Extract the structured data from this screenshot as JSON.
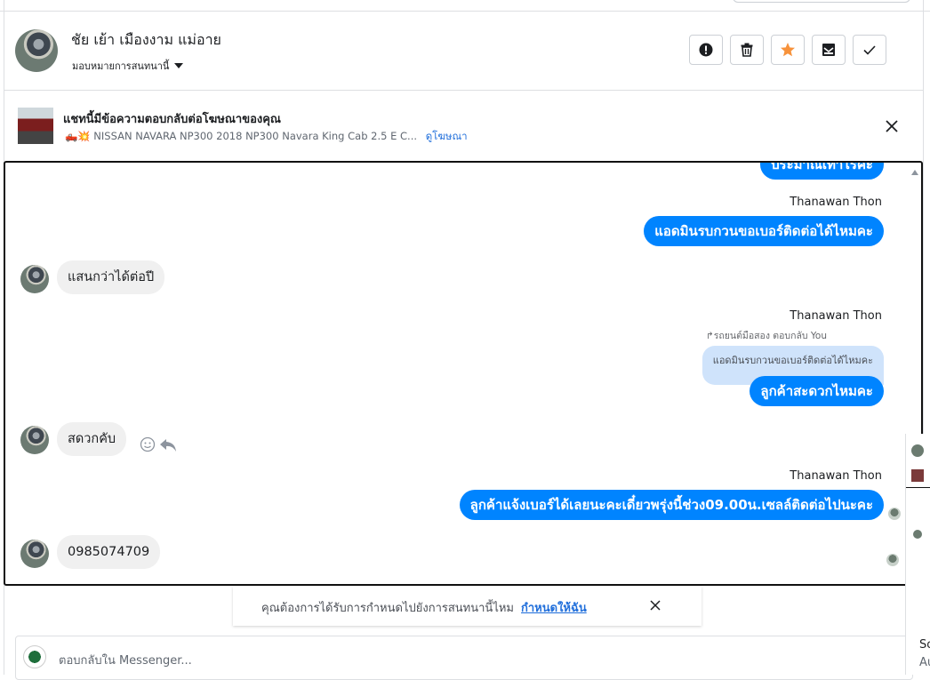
{
  "header": {
    "contact_name": "ชัย เย้า เมืองงาม แม่อาย",
    "assign_label": "มอบหมายการสนทนานี้",
    "actions": [
      {
        "name": "spam",
        "icon": "alert-circle-icon"
      },
      {
        "name": "delete",
        "icon": "trash-icon"
      },
      {
        "name": "star",
        "icon": "star-icon"
      },
      {
        "name": "mark-unread",
        "icon": "envelope-icon"
      },
      {
        "name": "done",
        "icon": "check-icon"
      }
    ]
  },
  "ad_banner": {
    "title": "แชทนี้มีข้อความตอบกลับต่อโฆษณาของคุณ",
    "subtitle": "🛻💥 NISSAN NAVARA NP300 2018 NP300 Navara King Cab 2.5 E C...",
    "link": "ดูโฆษณา"
  },
  "messages": {
    "out_1_partial": "ประมาณเท่าไรคะ",
    "sender_1": "Thanawan Thon",
    "out_2": "แอดมินรบกวนขอเบอร์ติดต่อได้ไหมคะ",
    "in_1": "แสนกว่าได้ต่อปี",
    "sender_2": "Thanawan Thon",
    "reply_meta": "รถยนต์มือสอง ตอบกลับ You",
    "quoted_text": "แอดมินรบกวนขอเบอร์ติดต่อได้ไหมคะ",
    "out_3": "ลูกค้าสะดวกไหมคะ",
    "in_2": "สดวกคับ",
    "sender_3": "Thanawan Thon",
    "out_4": "ลูกค้าแจ้งเบอร์ได้เลยนะคะเดี๋ยวพรุ่งนี้ช่วง09.00น.เซลล์ติดต่อไปนะคะ",
    "in_3": "0985074709"
  },
  "prompt": {
    "question": "คุณต้องการได้รับการกำหนดไปยังการสนทนานี้ไหม",
    "action": "กำหนดให้ฉัน"
  },
  "composer": {
    "placeholder": "ตอบกลับใน Messenger..."
  },
  "right_peek": {
    "text_1": "So",
    "text_2": "Au"
  },
  "colors": {
    "outgoing_bubble": "#0084ff",
    "incoming_bubble": "#f0f0f0",
    "star": "#f7923b",
    "link": "#216fdb"
  }
}
